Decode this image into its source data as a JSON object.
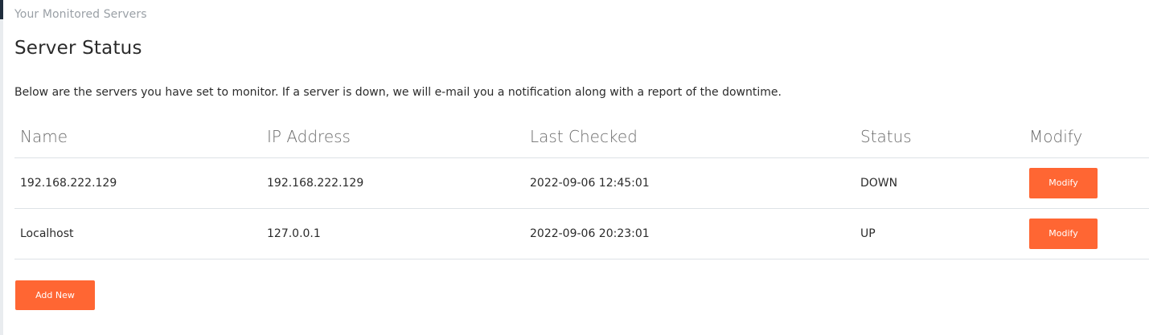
{
  "breadcrumb": "Your Monitored Servers",
  "title": "Server Status",
  "description": "Below are the servers you have set to monitor. If a server is down, we will e-mail you a notification along with a report of the downtime.",
  "table": {
    "headers": {
      "name": "Name",
      "ip": "IP Address",
      "last_checked": "Last Checked",
      "status": "Status",
      "modify": "Modify"
    },
    "rows": [
      {
        "name": "192.168.222.129",
        "ip": "192.168.222.129",
        "last_checked": "2022-09-06 12:45:01",
        "status": "DOWN",
        "modify_label": "Modify"
      },
      {
        "name": "Localhost",
        "ip": "127.0.0.1",
        "last_checked": "2022-09-06 20:23:01",
        "status": "UP",
        "modify_label": "Modify"
      }
    ]
  },
  "add_new_label": "Add New",
  "colors": {
    "accent": "#ff6633",
    "sidebar_edge": "#1f2d3d"
  }
}
